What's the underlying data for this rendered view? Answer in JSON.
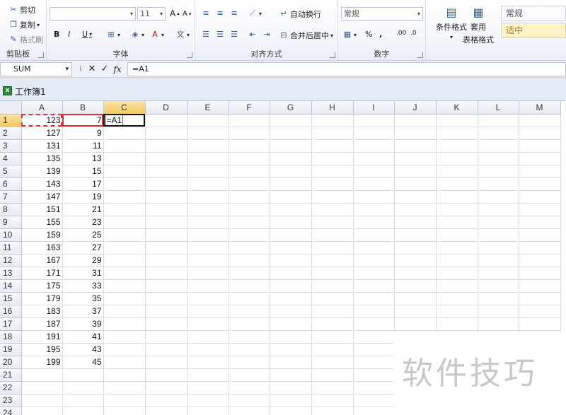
{
  "ribbon": {
    "clipboard": {
      "cut": "剪切",
      "copy": "复制",
      "format_painter": "格式刷",
      "label": "剪贴板"
    },
    "font": {
      "font_name": "",
      "font_size": "11",
      "bold": "B",
      "italic": "I",
      "underline": "U",
      "grow": "A",
      "shrink": "A",
      "label": "字体"
    },
    "alignment": {
      "wrap_text": "自动换行",
      "merge_center": "合并后居中",
      "label": "对齐方式"
    },
    "number": {
      "format": "常规",
      "percent": "%",
      "comma": ",",
      "increase_decimal": ".00",
      "decrease_decimal": ".0",
      "label": "数字"
    },
    "styles": {
      "conditional_format": "条件格式",
      "format_as_table_line1": "套用",
      "format_as_table_line2": "表格格式",
      "style_normal": "常规",
      "style_neutral": "适中"
    }
  },
  "formula_bar": {
    "name_box": "SUM",
    "cancel": "✕",
    "enter": "✓",
    "fx": "fx",
    "formula": "=A1"
  },
  "workbook": {
    "title": "工作簿1"
  },
  "columns": [
    "A",
    "B",
    "C",
    "D",
    "E",
    "F",
    "G",
    "H",
    "I",
    "J",
    "K",
    "L",
    "M"
  ],
  "rows": [
    {
      "num": "1",
      "a": "123",
      "b": "7",
      "c": "=A1"
    },
    {
      "num": "2",
      "a": "127",
      "b": "9",
      "c": ""
    },
    {
      "num": "3",
      "a": "131",
      "b": "11",
      "c": ""
    },
    {
      "num": "4",
      "a": "135",
      "b": "13",
      "c": ""
    },
    {
      "num": "5",
      "a": "139",
      "b": "15",
      "c": ""
    },
    {
      "num": "6",
      "a": "143",
      "b": "17",
      "c": ""
    },
    {
      "num": "7",
      "a": "147",
      "b": "19",
      "c": ""
    },
    {
      "num": "8",
      "a": "151",
      "b": "21",
      "c": ""
    },
    {
      "num": "9",
      "a": "155",
      "b": "23",
      "c": ""
    },
    {
      "num": "10",
      "a": "159",
      "b": "25",
      "c": ""
    },
    {
      "num": "11",
      "a": "163",
      "b": "27",
      "c": ""
    },
    {
      "num": "12",
      "a": "167",
      "b": "29",
      "c": ""
    },
    {
      "num": "13",
      "a": "171",
      "b": "31",
      "c": ""
    },
    {
      "num": "14",
      "a": "175",
      "b": "33",
      "c": ""
    },
    {
      "num": "15",
      "a": "179",
      "b": "35",
      "c": ""
    },
    {
      "num": "16",
      "a": "183",
      "b": "37",
      "c": ""
    },
    {
      "num": "17",
      "a": "187",
      "b": "39",
      "c": ""
    },
    {
      "num": "18",
      "a": "191",
      "b": "41",
      "c": ""
    },
    {
      "num": "19",
      "a": "195",
      "b": "43",
      "c": ""
    },
    {
      "num": "20",
      "a": "199",
      "b": "45",
      "c": ""
    },
    {
      "num": "21",
      "a": "",
      "b": "",
      "c": ""
    },
    {
      "num": "22",
      "a": "",
      "b": "",
      "c": ""
    },
    {
      "num": "23",
      "a": "",
      "b": "",
      "c": ""
    },
    {
      "num": "24",
      "a": "",
      "b": "",
      "c": ""
    }
  ],
  "selection": {
    "active_cell": "C1",
    "selected_column": "C",
    "selected_row": "1"
  },
  "watermark": "软件技巧",
  "colors": {
    "accent": "#f5c85e",
    "reference_border": "#d33333",
    "formula_text": "#2255bb"
  }
}
